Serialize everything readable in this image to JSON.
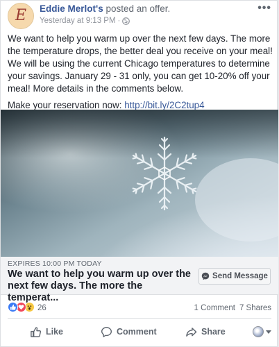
{
  "post": {
    "page_name": "Eddie Merlot's",
    "action_text": " posted an offer.",
    "timestamp": "Yesterday at 9:13 PM",
    "avatar_letter": "E",
    "paragraphs": [
      "We want to help you warm up over the next few days. The more the temperature drops, the better deal you receive on your meal! We will be using the current Chicago temperatures to determine your savings. January 29 - 31 only, you can get 10-20% off your meal! More details in the comments below."
    ],
    "reservation_prefix": "Make your reservation now: ",
    "reservation_link": "http://bit.ly/2C2tup4",
    "more_icon": "ellipsis-icon",
    "privacy_icon": "globe-icon"
  },
  "offer": {
    "expires": "EXPIRES 10:00 PM TODAY",
    "title": "We want to help you warm up over the next few days. The more the temperat...",
    "button_label": "Send Message",
    "button_icon": "messenger-icon"
  },
  "engagement": {
    "reaction_count": "26",
    "comments": "1 Comment",
    "shares": "7 Shares",
    "reaction_icons": [
      "like-icon",
      "love-icon",
      "wow-icon"
    ]
  },
  "actions": {
    "like": "Like",
    "comment": "Comment",
    "share": "Share"
  },
  "colors": {
    "link": "#385898",
    "like_reaction": "#3b7bf5",
    "love_reaction": "#f0475c",
    "wow_reaction": "#f7c843"
  }
}
